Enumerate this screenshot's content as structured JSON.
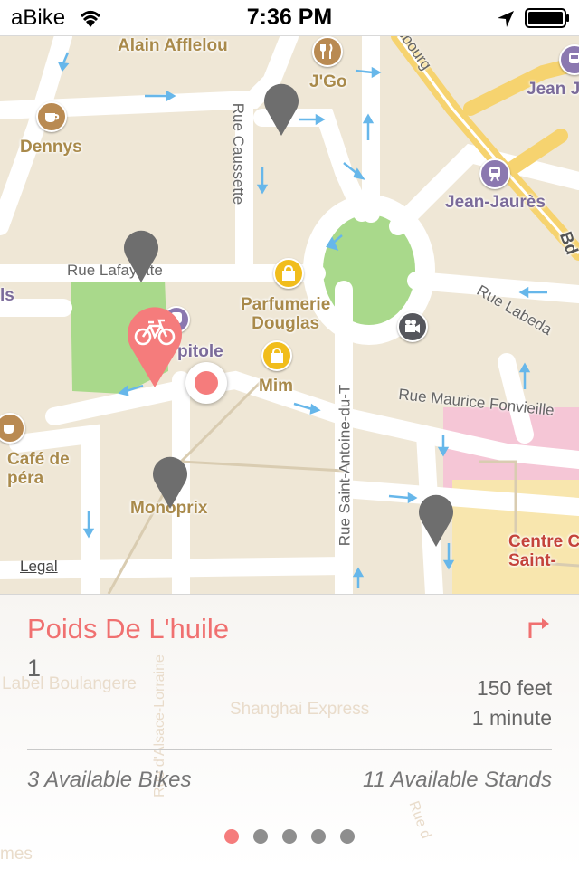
{
  "status_bar": {
    "carrier": "aBike",
    "time": "7:36 PM"
  },
  "map": {
    "labels": {
      "alain": "Alain Afflelou",
      "jgo": "J'Go",
      "dennys": "Dennys",
      "jean_top": "Jean J",
      "jean_jaures": "Jean-Jaurès",
      "bd": "Bd",
      "parfumerie": "Parfumerie\nDouglas",
      "capitole": "pitole",
      "mim": "Mim",
      "cafe": "Café de\npéra",
      "monoprix": "Monoprix",
      "centre": "Centre C\nSaint-",
      "ls": "ls"
    },
    "streets": {
      "caussette": "Rue Caussette",
      "lafayette": "Rue Lafayette",
      "labeda": "Rue Labeda",
      "fonvieille": "Rue Maurice Fonvieille",
      "antoine": "Rue Saint-Antoine-du-T",
      "strasbourg": "rasbourg"
    },
    "legal": "Legal"
  },
  "station": {
    "name": "Poids De L'huile",
    "number": "1",
    "distance": "150 feet",
    "duration": "1 minute",
    "bikes": "3 Available Bikes",
    "stands": "11 Available Stands"
  },
  "background_labels": {
    "boulangere": "Label Boulangere",
    "shanghai": "Shanghai Express",
    "alsace": "Rue d'Alsace-Lorraine",
    "rue_d": "Rue d",
    "mes": "mes"
  },
  "pager": {
    "count": 5,
    "active": 0
  },
  "colors": {
    "accent": "#f57c7c",
    "pin_gray": "#6e6e6e",
    "park": "#a9d98b",
    "road": "#ffffff",
    "land": "#efe7d6"
  }
}
